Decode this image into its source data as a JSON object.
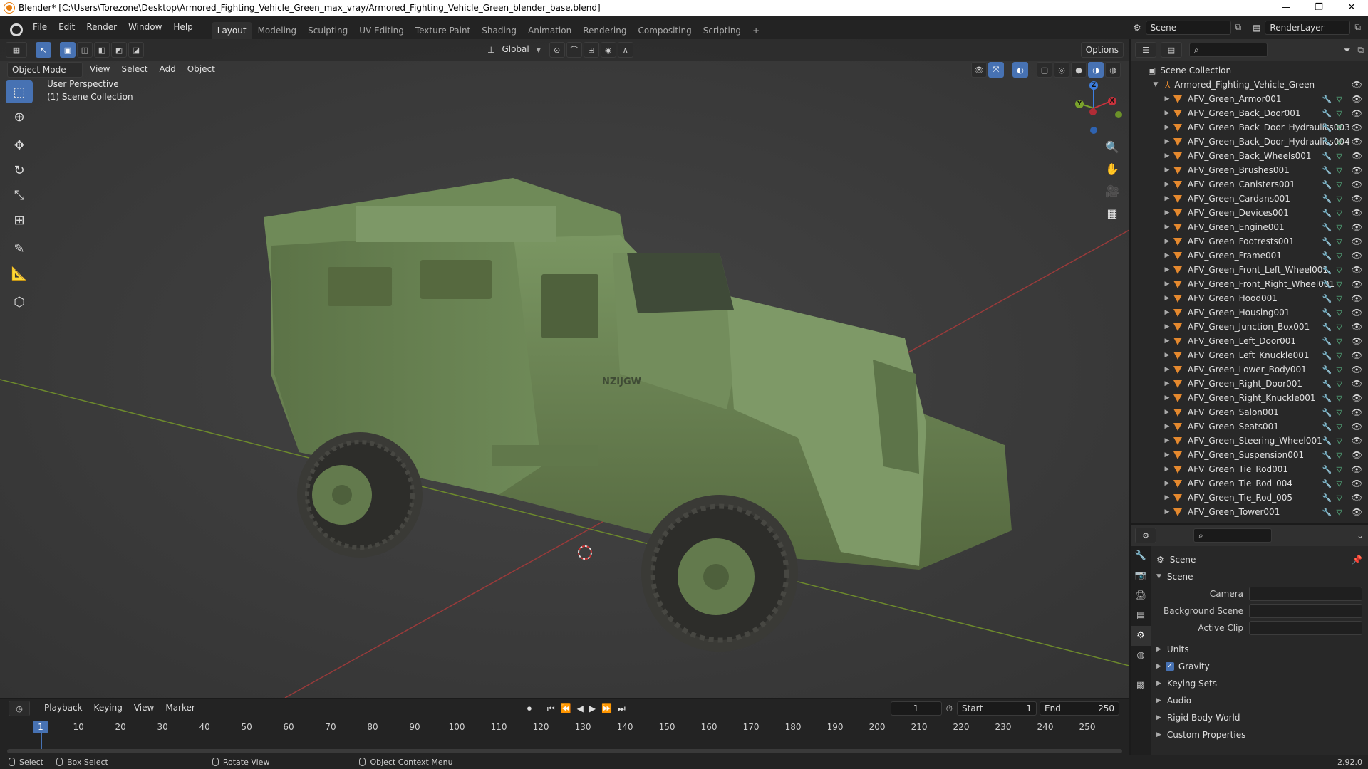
{
  "window": {
    "title": "Blender* [C:\\Users\\Torezone\\Desktop\\Armored_Fighting_Vehicle_Green_max_vray/Armored_Fighting_Vehicle_Green_blender_base.blend]",
    "minimize": "—",
    "maximize": "❐",
    "close": "✕"
  },
  "menu": [
    "File",
    "Edit",
    "Render",
    "Window",
    "Help"
  ],
  "workspaces": [
    "Layout",
    "Modeling",
    "Sculpting",
    "UV Editing",
    "Texture Paint",
    "Shading",
    "Animation",
    "Rendering",
    "Compositing",
    "Scripting"
  ],
  "add_workspace": "+",
  "scene_name": "Scene",
  "view_layer": "RenderLayer",
  "viewport": {
    "mode": "Object Mode",
    "menus": [
      "View",
      "Select",
      "Add",
      "Object"
    ],
    "orientation": "Global",
    "options": "Options",
    "info_line1": "User Perspective",
    "info_line2": "(1) Scene Collection",
    "gizmo": {
      "x": "X",
      "y": "Y",
      "z": "Z"
    },
    "decal": "NZIJGW"
  },
  "outliner": {
    "root": "Scene Collection",
    "collection": "Armored_Fighting_Vehicle_Green",
    "items": [
      "AFV_Green_Armor001",
      "AFV_Green_Back_Door001",
      "AFV_Green_Back_Door_Hydraulics003",
      "AFV_Green_Back_Door_Hydraulics004",
      "AFV_Green_Back_Wheels001",
      "AFV_Green_Brushes001",
      "AFV_Green_Canisters001",
      "AFV_Green_Cardans001",
      "AFV_Green_Devices001",
      "AFV_Green_Engine001",
      "AFV_Green_Footrests001",
      "AFV_Green_Frame001",
      "AFV_Green_Front_Left_Wheel001",
      "AFV_Green_Front_Right_Wheel001",
      "AFV_Green_Hood001",
      "AFV_Green_Housing001",
      "AFV_Green_Junction_Box001",
      "AFV_Green_Left_Door001",
      "AFV_Green_Left_Knuckle001",
      "AFV_Green_Lower_Body001",
      "AFV_Green_Right_Door001",
      "AFV_Green_Right_Knuckle001",
      "AFV_Green_Salon001",
      "AFV_Green_Seats001",
      "AFV_Green_Steering_Wheel001",
      "AFV_Green_Suspension001",
      "AFV_Green_Tie_Rod001",
      "AFV_Green_Tie_Rod_004",
      "AFV_Green_Tie_Rod_005",
      "AFV_Green_Tower001"
    ]
  },
  "properties": {
    "context": "Scene",
    "panel": "Scene",
    "camera_label": "Camera",
    "bg_scene_label": "Background Scene",
    "active_clip_label": "Active Clip",
    "sections": [
      "Units",
      "Gravity",
      "Keying Sets",
      "Audio",
      "Rigid Body World",
      "Custom Properties"
    ],
    "gravity_checked": true
  },
  "timeline": {
    "menus": [
      "Playback",
      "Keying",
      "View",
      "Marker"
    ],
    "current_frame": "1",
    "start_label": "Start",
    "start": "1",
    "end_label": "End",
    "end": "250",
    "ticks": [
      "1",
      "10",
      "20",
      "30",
      "40",
      "50",
      "60",
      "70",
      "80",
      "90",
      "100",
      "110",
      "120",
      "130",
      "140",
      "150",
      "160",
      "170",
      "180",
      "190",
      "200",
      "210",
      "220",
      "230",
      "240",
      "250"
    ]
  },
  "status": {
    "select": "Select",
    "box_select": "Box Select",
    "rotate_view": "Rotate View",
    "context_menu": "Object Context Menu",
    "version": "2.92.0"
  },
  "colors": {
    "accent": "#4772b3",
    "mesh": "#e5892e",
    "vehicle": "#6a8454",
    "axis_x": "#c8323c",
    "axis_y": "#7aa32c",
    "axis_z": "#3d7ee0"
  }
}
